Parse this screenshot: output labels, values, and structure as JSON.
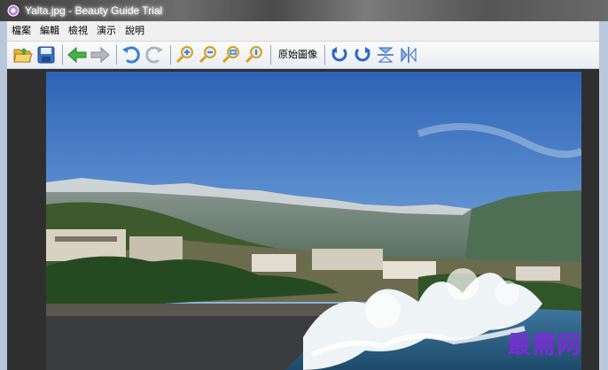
{
  "window": {
    "title": "Yalta.jpg - Beauty Guide Trial",
    "app_icon": "beauty-guide-app-icon"
  },
  "menu": {
    "items": [
      "檔案",
      "編輯",
      "檢視",
      "演示",
      "說明"
    ]
  },
  "toolbar": {
    "original_image_label": "原始圖像",
    "icons": [
      "open-folder-icon",
      "save-icon",
      "previous-arrow-icon",
      "next-arrow-icon",
      "undo-icon",
      "redo-icon",
      "zoom-in-icon",
      "zoom-out-icon",
      "zoom-fit-icon",
      "zoom-actual-icon",
      "rotate-left-icon",
      "rotate-right-icon",
      "flip-vertical-icon",
      "flip-horizontal-icon"
    ]
  },
  "image": {
    "subject": "seafront-photo",
    "watermark": "最需网"
  },
  "colors": {
    "accent": "#2f6fd0",
    "watermark": "#7a2bd6"
  }
}
